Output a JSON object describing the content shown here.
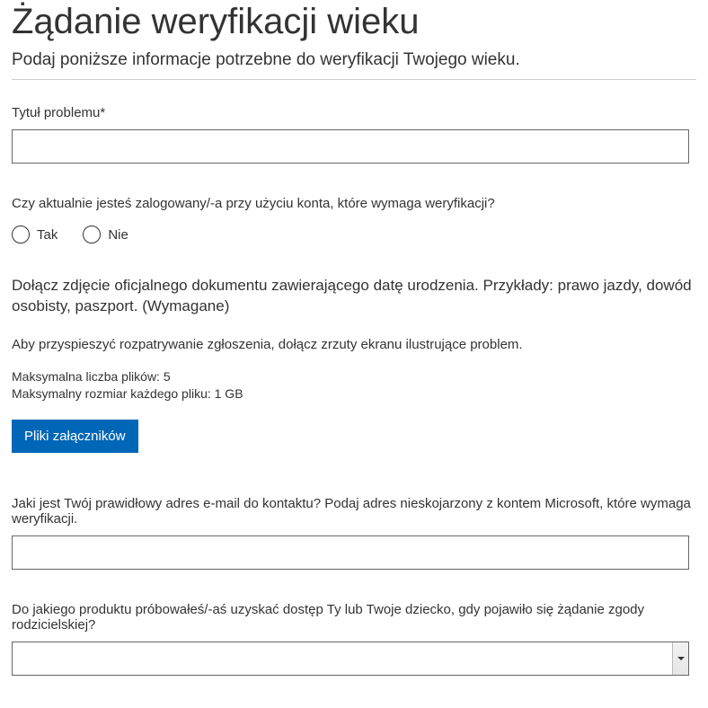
{
  "header": {
    "title": "Żądanie weryfikacji wieku",
    "subtitle": "Podaj poniższe informacje potrzebne do weryfikacji Twojego wieku."
  },
  "fields": {
    "problem_title": {
      "label": "Tytuł problemu*",
      "value": ""
    },
    "logged_in": {
      "label": "Czy aktualnie jesteś zalogowany/-a przy użyciu konta, które wymaga weryfikacji?",
      "options": {
        "yes": "Tak",
        "no": "Nie"
      }
    },
    "attachment": {
      "heading": "Dołącz zdjęcie oficjalnego dokumentu zawierającego datę urodzenia. Przykłady: prawo jazdy, dowód osobisty, paszport. (Wymagane)",
      "helper": "Aby przyspieszyć rozpatrywanie zgłoszenia, dołącz zrzuty ekranu ilustrujące problem.",
      "max_files": "Maksymalna liczba plików: 5",
      "max_size": "Maksymalny rozmiar każdego pliku: 1 GB",
      "button": "Pliki załączników"
    },
    "email": {
      "label": "Jaki jest Twój prawidłowy adres e-mail do kontaktu? Podaj adres nieskojarzony z kontem Microsoft, które wymaga weryfikacji.",
      "value": ""
    },
    "product": {
      "label": "Do jakiego produktu próbowałeś/-aś uzyskać dostęp Ty lub Twoje dziecko, gdy pojawiło się żądanie zgody rodzicielskiej?",
      "value": ""
    }
  }
}
